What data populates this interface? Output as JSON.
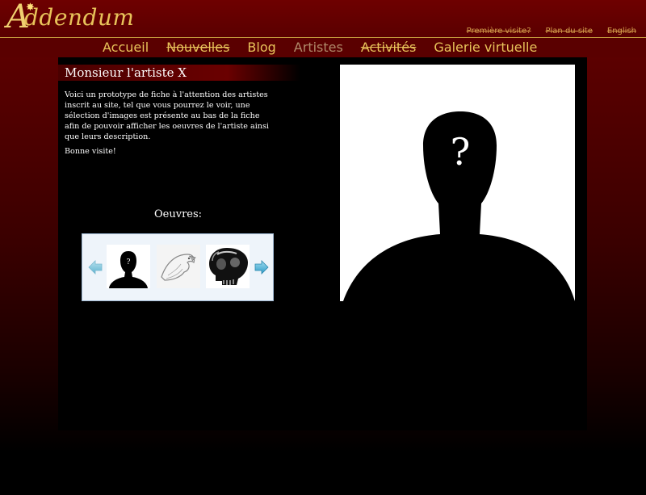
{
  "header": {
    "logo": {
      "letter": "A",
      "text": "ddendum"
    },
    "top_links": [
      "Première visite?",
      "Plan du site",
      "English"
    ]
  },
  "nav": {
    "items": [
      {
        "label": "Accueil",
        "strike": false,
        "active": false
      },
      {
        "label": "Nouvelles",
        "strike": true,
        "active": false
      },
      {
        "label": "Blog",
        "strike": false,
        "active": false
      },
      {
        "label": "Artistes",
        "strike": false,
        "active": true
      },
      {
        "label": "Activités",
        "strike": true,
        "active": false
      },
      {
        "label": "Galerie virtuelle",
        "strike": false,
        "active": false
      }
    ]
  },
  "artist": {
    "name": "Monsieur l'artiste X",
    "description": "Voici un prototype de fiche à l'attention des artistes inscrit au site, tel que vous pourrez le voir, une sélection d'images est présente au bas de la fiche afin de pouvoir afficher les oeuvres de l'artiste ainsi que leurs description.",
    "greeting": "Bonne visite!",
    "portrait_mark": "?"
  },
  "works": {
    "label": "Oeuvres:",
    "thumb_mark": "?"
  },
  "colors": {
    "accent": "#e8c35a",
    "background": "#5a0000",
    "panel": "#000000"
  }
}
